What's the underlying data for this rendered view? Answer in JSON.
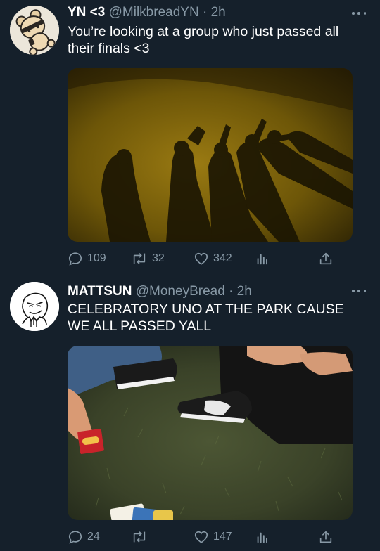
{
  "tweets": [
    {
      "display_name": "YN <3",
      "handle": "@MilkbreadYN",
      "time": "2h",
      "text": "You’re looking at a group who just passed all their finals <3",
      "avatar_icon": "bear-avatar-icon",
      "media_description": "shadows",
      "replies": "109",
      "retweets": "32",
      "likes": "342"
    },
    {
      "display_name": "MATTSUN",
      "handle": "@MoneyBread",
      "time": "2h",
      "text": "CELEBRATORY UNO AT THE PARK CAUSE WE ALL PASSED YALL",
      "avatar_icon": "meme-face-avatar-icon",
      "media_description": "uno",
      "replies": "24",
      "retweets": "",
      "likes": "147"
    }
  ],
  "separator": "·",
  "colors": {
    "background": "#15202b",
    "muted": "#8899a6",
    "divider": "#38444d"
  }
}
